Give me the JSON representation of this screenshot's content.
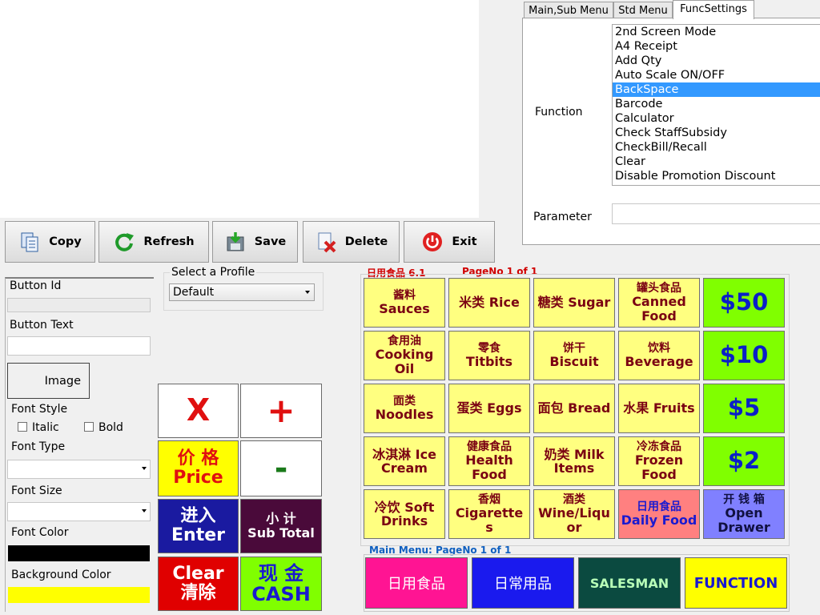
{
  "tabs": [
    "Main,Sub Menu",
    "Std Menu",
    "FuncSettings"
  ],
  "func": {
    "function_label": "Function",
    "parameter_label": "Parameter",
    "items": [
      "2nd Screen Mode",
      "A4 Receipt",
      "Add Qty",
      "Auto Scale ON/OFF",
      "BackSpace",
      "Barcode",
      "Calculator",
      "Check StaffSubsidy",
      "CheckBill/Recall",
      "Clear",
      "Disable Promotion Discount"
    ],
    "selected": "BackSpace",
    "parameter_value": ""
  },
  "toolbar": {
    "copy": "Copy",
    "refresh": "Refresh",
    "save": "Save",
    "delete": "Delete",
    "exit": "Exit"
  },
  "props": {
    "button_id_label": "Button Id",
    "button_id_value": "",
    "button_text_label": "Button Text",
    "button_text_value": "",
    "image_label": "Image",
    "font_style_label": "Font Style",
    "italic_label": "Italic",
    "bold_label": "Bold",
    "font_type_label": "Font Type",
    "font_size_label": "Font Size",
    "font_color_label": "Font Color",
    "font_color": "#000000",
    "bg_color_label": "Background Color",
    "bg_color": "#ffff00"
  },
  "profile": {
    "label": "Select a Profile",
    "value": "Default"
  },
  "keypad": {
    "x": "X",
    "plus": "+",
    "price_zh": "价 格",
    "price_en": "Price",
    "minus": "-",
    "enter_zh": "进入",
    "enter_en": "Enter",
    "subtotal_zh": "小 计",
    "subtotal_en": "Sub Total",
    "clear_en": "Clear",
    "clear_zh": "清除",
    "cash_zh": "现 金",
    "cash_en": "CASH"
  },
  "grid": {
    "header_title": "日用食品 6.1",
    "header_page": "PageNo 1 of 1",
    "row1": [
      {
        "zh": "酱料",
        "en": "Sauces"
      },
      {
        "zh": "",
        "en": "米类 Rice"
      },
      {
        "zh": "",
        "en": "糖类 Sugar"
      },
      {
        "zh": "罐头食品",
        "en": "Canned Food"
      },
      {
        "zh": "",
        "en": "$50"
      }
    ],
    "row2": [
      {
        "zh": "食用油",
        "en": "Cooking Oil"
      },
      {
        "zh": "零食",
        "en": "Titbits"
      },
      {
        "zh": "饼干",
        "en": "Biscuit"
      },
      {
        "zh": "饮料",
        "en": "Beverage"
      },
      {
        "zh": "",
        "en": "$10"
      }
    ],
    "row3": [
      {
        "zh": "面类",
        "en": "Noodles"
      },
      {
        "zh": "",
        "en": "蛋类 Eggs"
      },
      {
        "zh": "",
        "en": "面包 Bread"
      },
      {
        "zh": "",
        "en": "水果 Fruits"
      },
      {
        "zh": "",
        "en": "$5"
      }
    ],
    "row4": [
      {
        "zh": "",
        "en": "冰淇淋 Ice Cream"
      },
      {
        "zh": "健康食品",
        "en": "Health Food"
      },
      {
        "zh": "",
        "en": "奶类 Milk Items"
      },
      {
        "zh": "冷冻食品",
        "en": "Frozen Food"
      },
      {
        "zh": "",
        "en": "$2"
      }
    ],
    "row5": [
      {
        "zh": "",
        "en": "冷饮 Soft Drinks"
      },
      {
        "zh": "香烟",
        "en": "Cigarettes"
      },
      {
        "zh": "酒类",
        "en": "Wine/Liquor"
      },
      {
        "zh": "日用食品",
        "en": "Daily Food"
      },
      {
        "zh": "开 钱 箱",
        "en": "Open Drawer"
      }
    ]
  },
  "main_menu": {
    "label": "Main Menu: PageNo 1 of  1",
    "items": [
      "日用食品",
      "日常用品",
      "SALESMAN",
      "FUNCTION"
    ]
  },
  "colors": {
    "grid_yellow": "#ffff80",
    "money_green": "#80ff00",
    "daily_food_pink": "#ff8080",
    "open_drawer_purple": "#8080ff",
    "menu_pink": "#ff1493",
    "menu_blue": "#1a1aee",
    "menu_dark_green": "#0b4a40",
    "menu_yellow": "#ffff00"
  }
}
